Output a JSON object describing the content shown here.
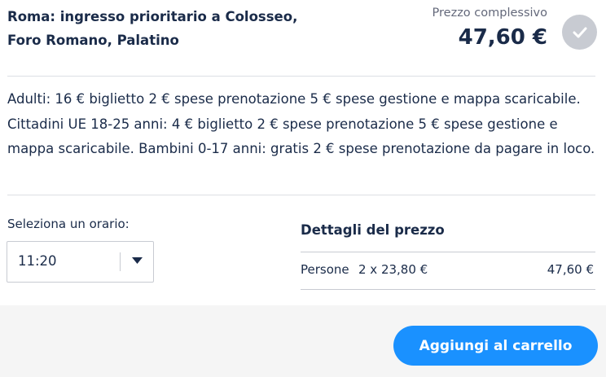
{
  "product": {
    "title_line1": "Roma: ingresso prioritario a Colosseo,",
    "title_line2": "Foro Romano, Palatino"
  },
  "price": {
    "label": "Prezzo complessivo",
    "total": "47,60 €"
  },
  "description": "Adulti: 16 € biglietto 2 € spese prenotazione 5 € spese gestione e mappa scaricabile. Cittadini UE 18-25 anni: 4 € biglietto 2 € spese prenotazione 5 € spese gestione e mappa scaricabile. Bambini 0-17 anni: gratis 2 € spese prenotazione da pagare in loco.",
  "time_picker": {
    "label": "Seleziona un orario:",
    "selected": "11:20"
  },
  "price_details": {
    "title": "Dettagli del prezzo",
    "rows": [
      {
        "label": "Persone",
        "quantity": "2 x 23,80 €",
        "amount": "47,60 €"
      }
    ]
  },
  "actions": {
    "add_to_cart": "Aggiungi al carrello"
  },
  "colors": {
    "primary_text": "#1a2b49",
    "button_blue": "#1a91ff",
    "check_gray": "#c8cbd2",
    "footer_bg": "#f5f5f5"
  },
  "icons": {
    "status": "check-icon",
    "dropdown": "caret-down-icon"
  }
}
